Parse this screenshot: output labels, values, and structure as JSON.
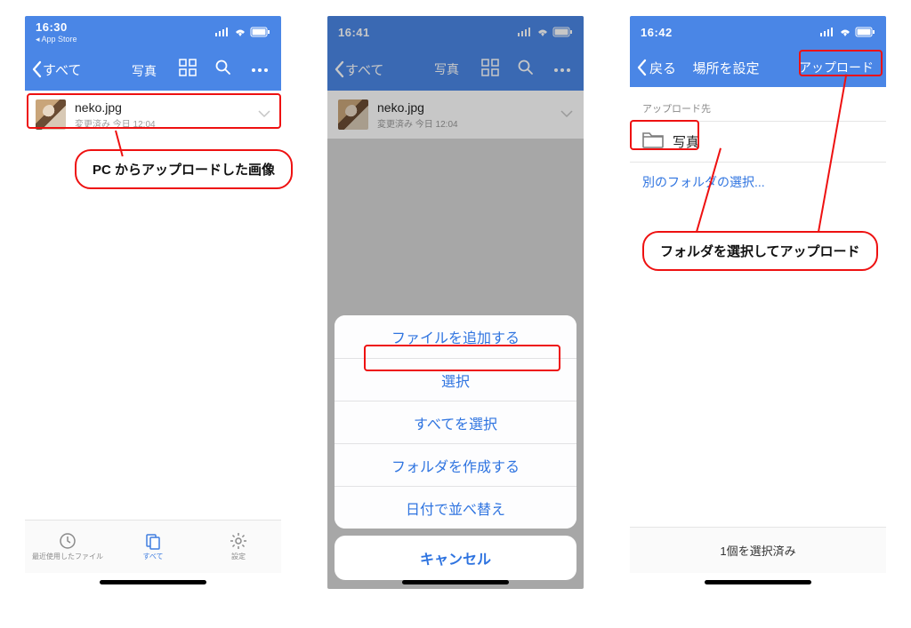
{
  "screen1": {
    "status": {
      "time": "16:30",
      "sub": "◂ App Store"
    },
    "nav": {
      "back": "すべて",
      "title": "写真"
    },
    "file": {
      "name": "neko.jpg",
      "sub": "変更済み 今日 12:04"
    },
    "tabs": {
      "recent": "最近使用したファイル",
      "all": "すべて",
      "settings": "設定"
    },
    "callout": "PC からアップロードした画像"
  },
  "screen2": {
    "status": {
      "time": "16:41"
    },
    "nav": {
      "back": "すべて",
      "title": "写真"
    },
    "file": {
      "name": "neko.jpg",
      "sub": "変更済み 今日 12:04"
    },
    "sheet": {
      "items": [
        "ファイルを追加する",
        "選択",
        "すべてを選択",
        "フォルダを作成する",
        "日付で並べ替え"
      ],
      "cancel": "キャンセル"
    }
  },
  "screen3": {
    "status": {
      "time": "16:42"
    },
    "nav": {
      "back": "戻る",
      "title": "場所を設定",
      "right": "アップロード"
    },
    "sectionLabel": "アップロード先",
    "folder": "写真",
    "link": "別のフォルダの選択...",
    "footer": "1個を選択済み",
    "callout": "フォルダを選択してアップロード"
  }
}
